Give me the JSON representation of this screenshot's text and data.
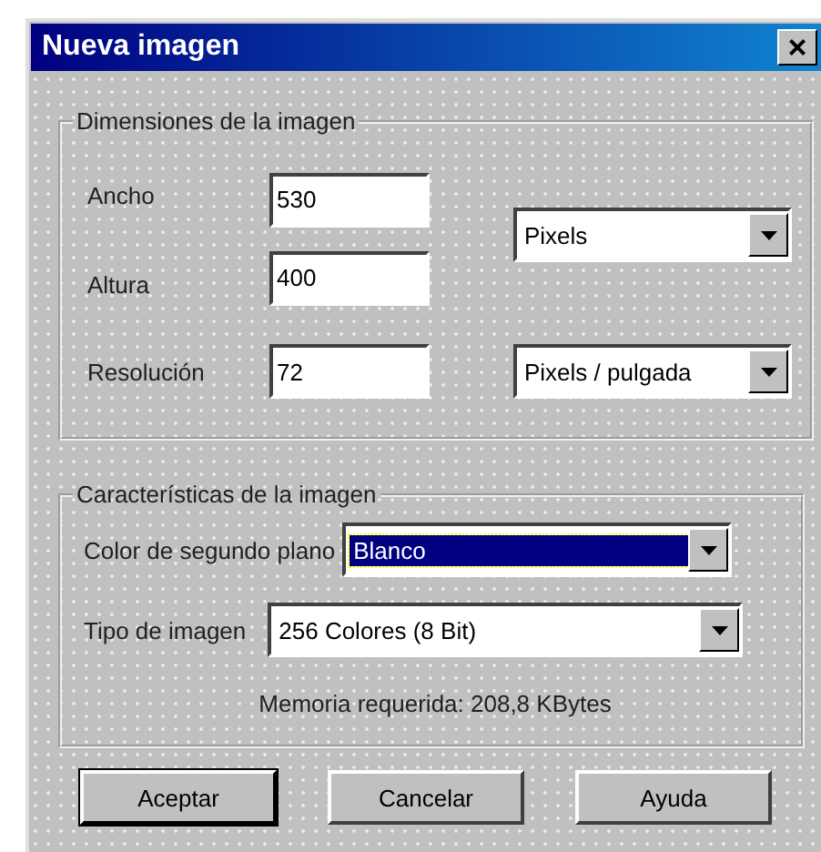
{
  "window": {
    "title": "Nueva imagen",
    "close": "×"
  },
  "dimensions": {
    "title": "Dimensiones de la imagen",
    "fields": [
      {
        "label": "Ancho",
        "value": "530"
      },
      {
        "label": "Altura",
        "value": "400"
      },
      {
        "label": "Resolución",
        "value": "72"
      }
    ],
    "size_unit": {
      "value": "Pixels"
    },
    "resolution_unit": {
      "value": "Pixels / pulgada"
    }
  },
  "characteristics": {
    "title": "Características de la imagen",
    "background": {
      "label": "Color de segundo plano",
      "value": "Blanco",
      "focused": true
    },
    "image_type": {
      "label": "Tipo de imagen",
      "value": "256 Colores (8 Bit)",
      "focused": false
    },
    "memory": "Memoria requerida: 208,8 KBytes"
  },
  "buttons": [
    {
      "label": "Aceptar",
      "default": true
    },
    {
      "label": "Cancelar",
      "default": false
    },
    {
      "label": "Ayuda",
      "default": false
    }
  ]
}
